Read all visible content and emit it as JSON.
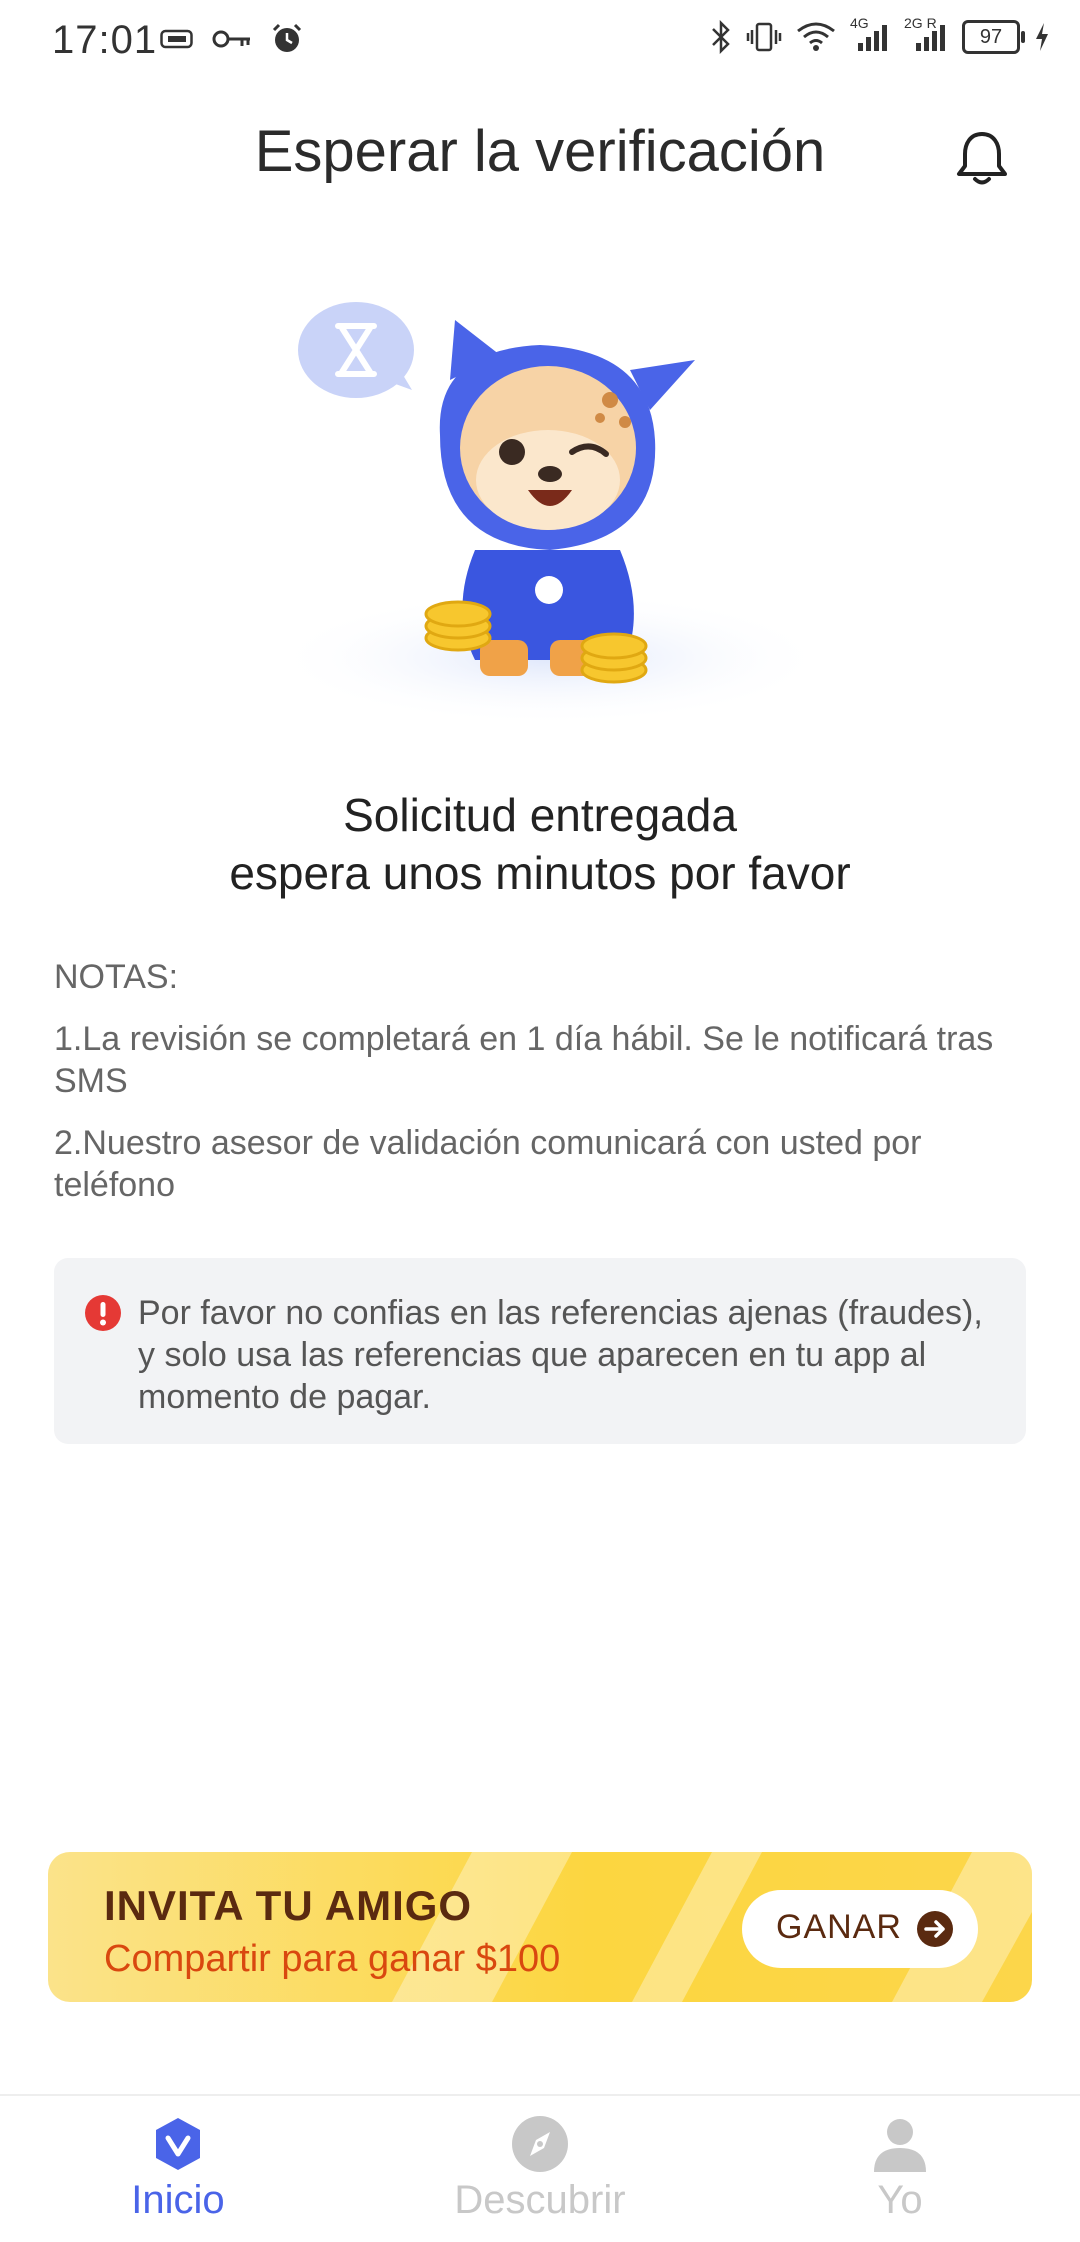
{
  "status_bar": {
    "time": "17:01",
    "battery": "97",
    "icons": [
      "sim-icon",
      "key-icon",
      "alarm-icon",
      "bluetooth-icon",
      "vibrate-icon",
      "wifi-icon",
      "signal-4g-icon",
      "signal-2g-icon",
      "battery-icon",
      "charging-icon"
    ],
    "net_label_1": "4G",
    "net_label_2": "2G R"
  },
  "header": {
    "title": "Esperar la verificación",
    "bell_icon": "bell-icon"
  },
  "illustration": {
    "icon": "mascot-illustration"
  },
  "message": {
    "line1": "Solicitud entregada",
    "line2": "espera unos minutos por favor"
  },
  "notes": {
    "title": "NOTAS:",
    "items": [
      "1.La revisión se completará en 1 día hábil. Se le notificará tras SMS",
      "2.Nuestro asesor de validación comunicará con usted por teléfono"
    ]
  },
  "warning": {
    "icon": "alert-icon",
    "text": "Por favor no confias en las referencias ajenas (fraudes), y solo usa las referencias que aparecen en tu app al momento de pagar."
  },
  "promo": {
    "title": "INVITA TU AMIGO",
    "subtitle": "Compartir para ganar $100",
    "button_label": "GANAR",
    "button_icon": "arrow-right-icon"
  },
  "bottom_nav": {
    "items": [
      {
        "label": "Inicio",
        "icon": "home-icon",
        "active": true
      },
      {
        "label": "Descubrir",
        "icon": "compass-icon",
        "active": false
      },
      {
        "label": "Yo",
        "icon": "person-icon",
        "active": false
      }
    ]
  },
  "colors": {
    "accent": "#4a64e8",
    "inactive": "#c8c8c8",
    "promo_title": "#5a2a10",
    "promo_sub": "#d9480f",
    "alert": "#e53935"
  }
}
